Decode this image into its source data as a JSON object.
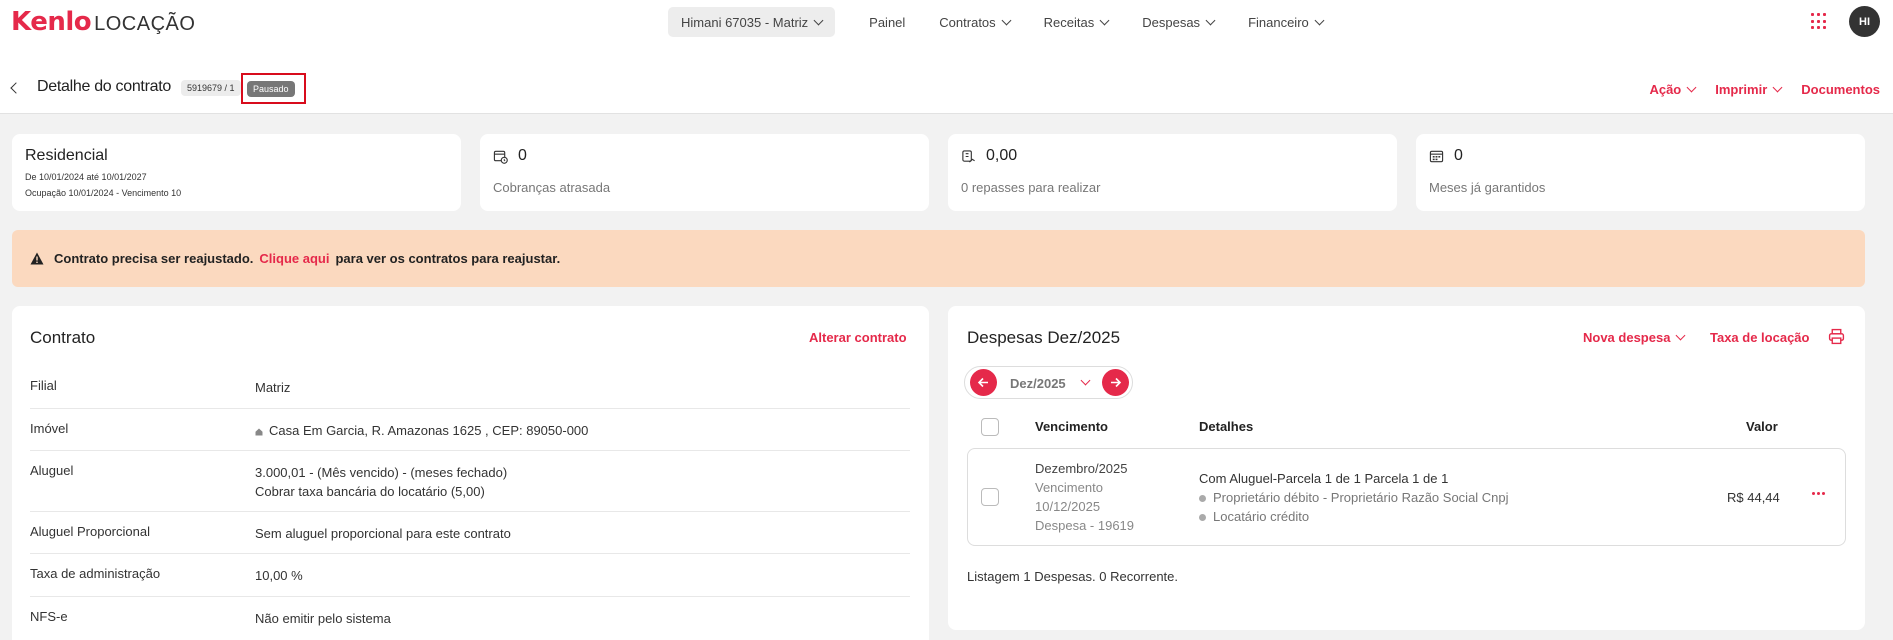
{
  "app": {
    "logo_main": "Kenlo",
    "logo_sub": "LOCAÇÃO",
    "avatar_initials": "HI"
  },
  "nav": {
    "branch": "Himani 67035 - Matriz",
    "items": [
      "Painel",
      "Contratos",
      "Receitas",
      "Despesas",
      "Financeiro"
    ]
  },
  "header": {
    "title": "Detalhe do contrato",
    "contract_number": "5919679 / 1",
    "status": "Pausado",
    "actions": [
      "Ação",
      "Imprimir",
      "Documentos"
    ]
  },
  "summary": {
    "type": "Residencial",
    "period": "De 10/01/2024 até 10/01/2027",
    "occupancy": "Ocupação 10/01/2024 - Vencimento 10",
    "stats": [
      {
        "value": "0",
        "label": "Cobranças atrasada",
        "icon": "calendar-clock-icon"
      },
      {
        "value": "0,00",
        "label": "0 repasses para realizar",
        "icon": "money-hand-icon"
      },
      {
        "value": "0",
        "label": "Meses já garantidos",
        "icon": "calendar-grid-icon"
      }
    ]
  },
  "alert": {
    "text_before": "Contrato precisa ser reajustado.",
    "link": "Clique aqui",
    "text_after": "para ver os contratos para reajustar."
  },
  "contract": {
    "title": "Contrato",
    "edit_link": "Alterar contrato",
    "rows": [
      {
        "key": "Filial",
        "value": "Matriz"
      },
      {
        "key": "Imóvel",
        "value": "Casa Em Garcia, R. Amazonas 1625 , CEP: 89050-000"
      },
      {
        "key": "Aluguel",
        "value": "3.000,01 - (Mês vencido) - (meses fechado)",
        "value2": "Cobrar taxa bancária do locatário (5,00)"
      },
      {
        "key": "Aluguel Proporcional",
        "value": "Sem aluguel proporcional para este contrato"
      },
      {
        "key": "Taxa de administração",
        "value": "10,00 %"
      },
      {
        "key": "NFS-e",
        "value": "Não emitir pelo sistema"
      }
    ]
  },
  "expenses": {
    "title": "Despesas Dez/2025",
    "new_label": "Nova despesa",
    "fee_label": "Taxa de locação",
    "month": "Dez/2025",
    "columns": {
      "due": "Vencimento",
      "details": "Detalhes",
      "value": "Valor"
    },
    "items": [
      {
        "month": "Dezembro/2025",
        "due_label": "Vencimento",
        "due_date": "10/12/2025",
        "expense_id": "Despesa - 19619",
        "description": "Com Aluguel-Parcela 1 de 1 Parcela 1 de 1",
        "debit": "Proprietário débito - Proprietário Razão Social Cnpj",
        "credit": "Locatário crédito",
        "value": "R$ 44,44"
      }
    ],
    "footer": "Listagem 1 Despesas. 0 Recorrente."
  },
  "colors": {
    "accent": "#e5294a",
    "alert_bg": "#fbd9bf",
    "status_badge": "#777777"
  }
}
